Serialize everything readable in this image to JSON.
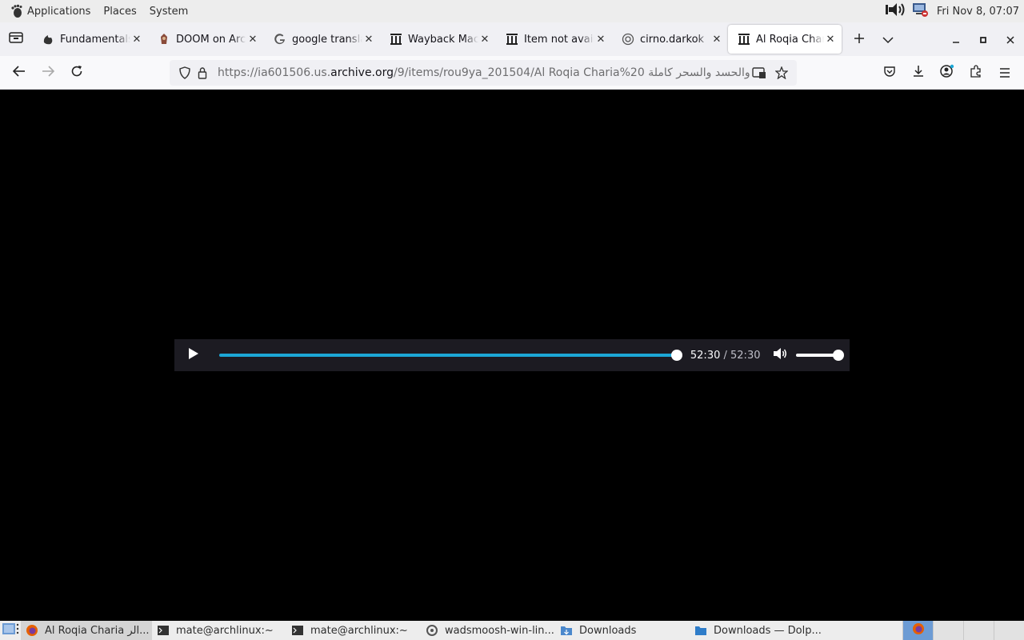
{
  "top_panel": {
    "menus": [
      "Applications",
      "Places",
      "System"
    ],
    "clock": "Fri Nov  8, 07:07"
  },
  "tabs": [
    {
      "title": "Fundamentals",
      "icon": "flame-icon"
    },
    {
      "title": "DOOM on Arch",
      "icon": "doom-icon"
    },
    {
      "title": "google translate",
      "icon": "google-icon"
    },
    {
      "title": "Wayback Machine",
      "icon": "archive-icon"
    },
    {
      "title": "Item not available",
      "icon": "archive-icon"
    },
    {
      "title": "cirno.darkok",
      "icon": "globe-icon"
    },
    {
      "title": "Al Roqia Charia",
      "icon": "archive-icon",
      "active": true
    }
  ],
  "urlbar": {
    "prefix": "https://ia601506.us.",
    "domain": "archive.org",
    "path": "/9/items/rou9ya_201504/Al Roqia Charia%20 والحسد والسحر كاملة"
  },
  "player": {
    "current_time": "52:30",
    "separator": " / ",
    "duration": "52:30",
    "progress": 1.0,
    "volume": 1.0
  },
  "taskbar": {
    "items": [
      {
        "label": "Al Roqia Charia الر...",
        "icon": "firefox-icon",
        "active": true
      },
      {
        "label": "mate@archlinux:~",
        "icon": "terminal-icon"
      },
      {
        "label": "mate@archlinux:~",
        "icon": "terminal-icon"
      },
      {
        "label": "wadsmoosh-win-lin...",
        "icon": "script-icon"
      },
      {
        "label": "Downloads",
        "icon": "folder-icon"
      },
      {
        "label": "Downloads — Dolp...",
        "icon": "folder-icon"
      }
    ]
  },
  "colors": {
    "accent": "#1ca7d6",
    "player_bg": "#1c1b22",
    "panel_bg": "#ededed"
  }
}
